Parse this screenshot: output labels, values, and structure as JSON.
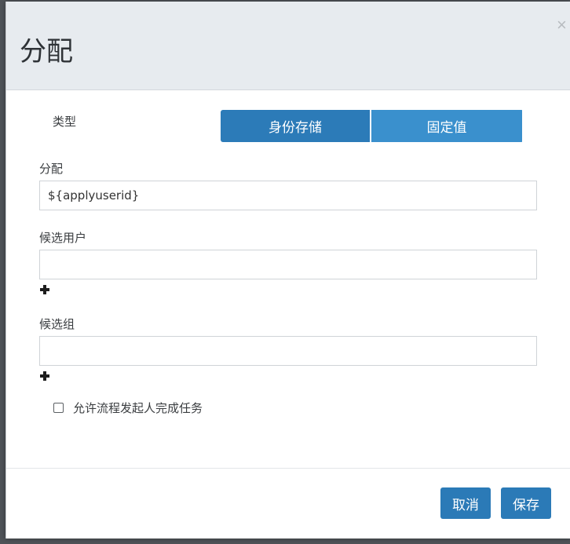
{
  "dialog": {
    "title": "分配",
    "close_glyph": "×"
  },
  "type_section": {
    "label": "类型",
    "options": [
      "身份存储",
      "固定值"
    ]
  },
  "assignee": {
    "label": "分配",
    "value": "${applyuserid}"
  },
  "candidate_users": {
    "label": "候选用户",
    "value": "",
    "add_icon": "plus-icon"
  },
  "candidate_groups": {
    "label": "候选组",
    "value": "",
    "add_icon": "plus-icon"
  },
  "initiator_option": {
    "label": "允许流程发起人完成任务",
    "checked": false
  },
  "footer": {
    "cancel_label": "取消",
    "save_label": "保存"
  },
  "colors": {
    "primary": "#2b7ab7",
    "segment_secondary": "#3a90cd",
    "header_bg": "#e7ebef"
  }
}
